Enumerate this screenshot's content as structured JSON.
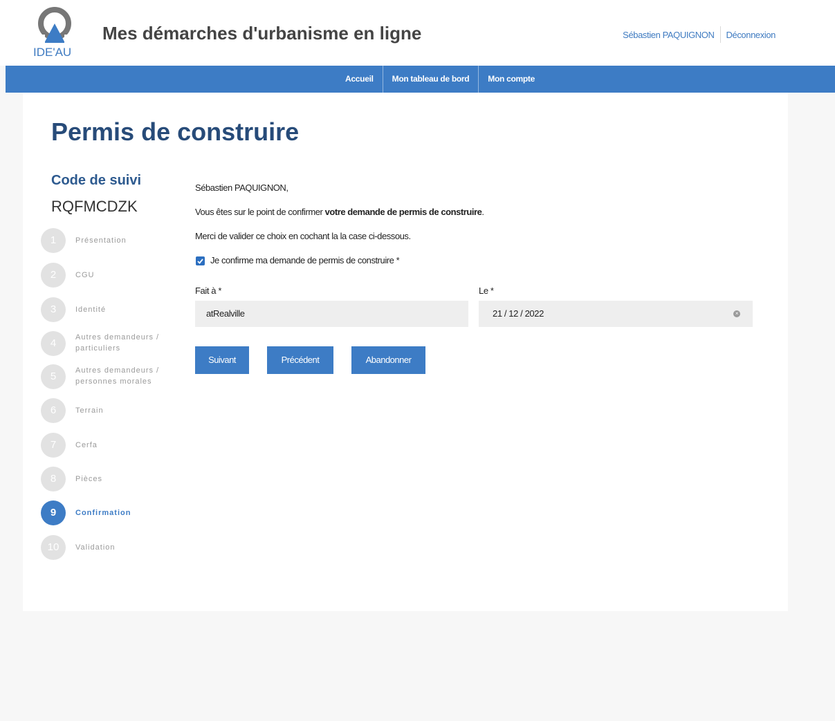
{
  "header": {
    "logo_text": "IDE'AU",
    "site_title": "Mes démarches d'urbanisme en ligne",
    "user_name": "Sébastien PAQUIGNON",
    "logout": "Déconnexion",
    "brand_color": "#3d7cc5"
  },
  "nav": {
    "items": [
      {
        "label": "Accueil"
      },
      {
        "label": "Mon tableau de bord"
      },
      {
        "label": "Mon compte"
      }
    ]
  },
  "main": {
    "page_title": "Permis de construire",
    "code_label": "Code de suivi",
    "code_value": "RQFMCDZK"
  },
  "steps": [
    {
      "number": "1",
      "label": "Présentation"
    },
    {
      "number": "2",
      "label": "CGU"
    },
    {
      "number": "3",
      "label": "Identité"
    },
    {
      "number": "4",
      "label": "Autres demandeurs / particuliers"
    },
    {
      "number": "5",
      "label": "Autres demandeurs / personnes morales"
    },
    {
      "number": "6",
      "label": "Terrain"
    },
    {
      "number": "7",
      "label": "Cerfa"
    },
    {
      "number": "8",
      "label": "Pièces"
    },
    {
      "number": "9",
      "label": "Confirmation",
      "active": true
    },
    {
      "number": "10",
      "label": "Validation"
    }
  ],
  "form": {
    "greeting": "Sébastien PAQUIGNON,",
    "intro_prefix": "Vous êtes sur le point de confirmer ",
    "intro_bold": "votre demande de permis de construire",
    "intro_suffix": ".",
    "instruction": "Merci de valider ce choix en cochant la la case ci-dessous.",
    "checkbox_label": "Je confirme ma demande de permis de construire *",
    "checkbox_checked": true,
    "fait_label": "Fait à *",
    "fait_value": "atRealville",
    "le_label": "Le *",
    "le_value": "21 / 12 / 2022",
    "buttons": {
      "next": "Suivant",
      "prev": "Précédent",
      "quit": "Abandonner"
    }
  }
}
